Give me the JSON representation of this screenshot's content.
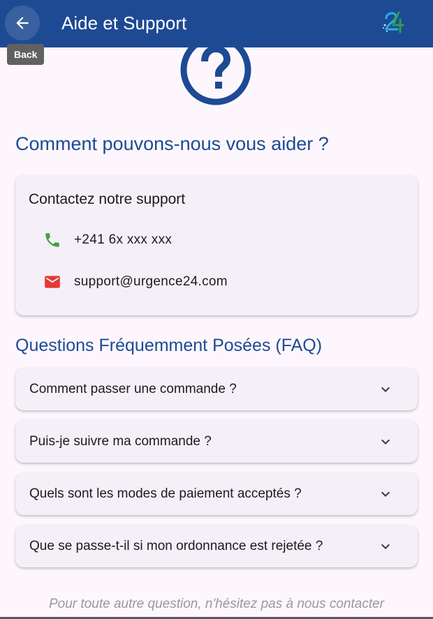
{
  "appbar": {
    "title": "Aide et Support",
    "back_tooltip": "Back",
    "back_icon": "arrow-left-icon",
    "logo_icon": "urgence24-logo",
    "color": "#1e4a94"
  },
  "hero_icon": "help-circle-icon",
  "main_heading": "Comment pouvons-nous vous aider ?",
  "contact": {
    "title": "Contactez notre support",
    "phone": {
      "icon": "phone-icon",
      "value": "+241 6x xxx xxx",
      "icon_color": "#43a047"
    },
    "email": {
      "icon": "mail-icon",
      "value": "support@urgence24.com",
      "icon_color": "#e53935"
    }
  },
  "faq": {
    "heading": "Questions Fréquemment Posées (FAQ)",
    "items": [
      {
        "question": "Comment passer une commande ?"
      },
      {
        "question": "Puis-je suivre ma commande ?"
      },
      {
        "question": "Quels sont les modes de paiement acceptés ?"
      },
      {
        "question": "Que se passe-t-il si mon ordonnance est rejetée ?"
      }
    ],
    "expand_icon": "chevron-down-icon"
  },
  "footer_note": "Pour toute autre question, n'hésitez pas à nous contacter"
}
